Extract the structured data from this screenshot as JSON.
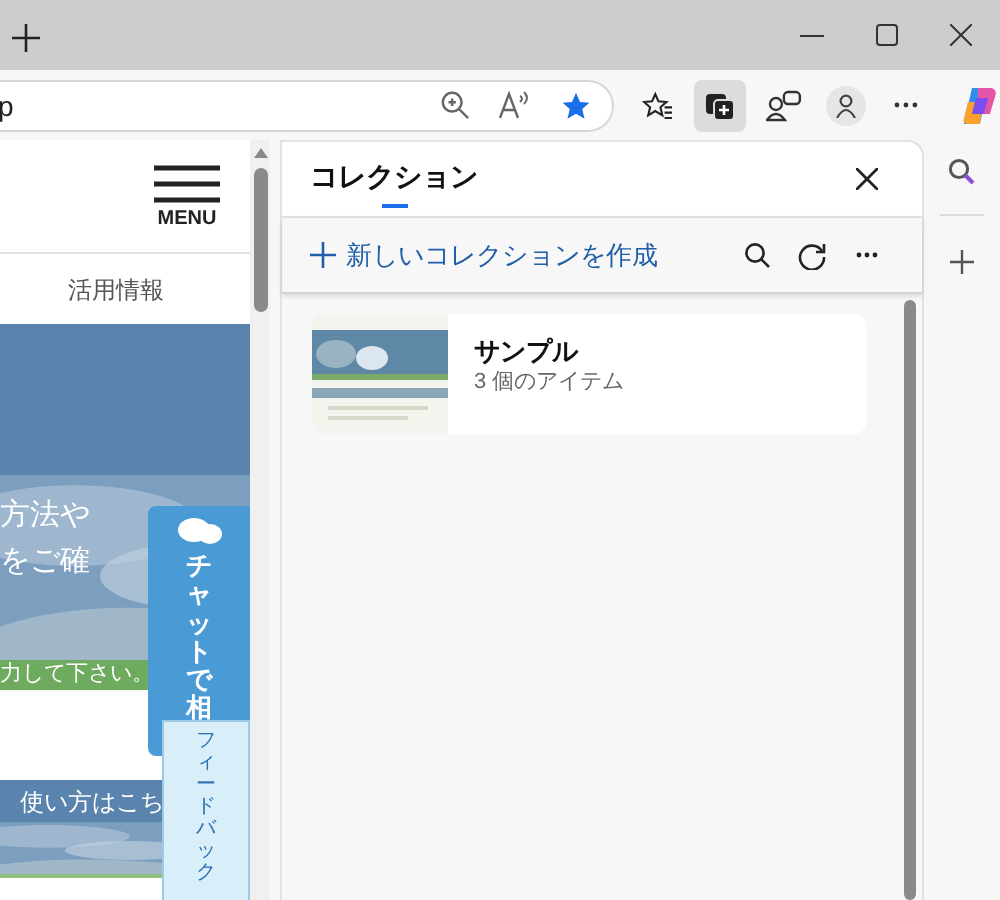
{
  "browser": {
    "address_text": "p",
    "favorite": true,
    "collections_active": true
  },
  "page": {
    "menu_label": "MENU",
    "nav_link": "活用情報",
    "hero_lines": [
      "方法や",
      "をご確"
    ],
    "notice": "力して下さい。",
    "banner": "使い方はこち",
    "chat_button": "チャットで相",
    "feedback_tab": "フィードバック"
  },
  "collections_panel": {
    "title": "コレクション",
    "new_collection": "新しいコレクションを作成",
    "collections": [
      {
        "name": "サンプル",
        "item_count": "3 個のアイテム"
      }
    ]
  }
}
